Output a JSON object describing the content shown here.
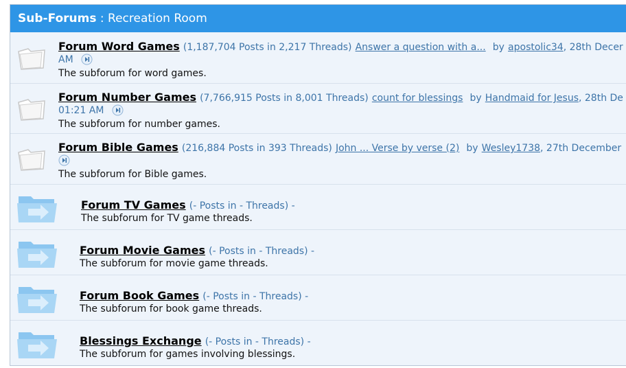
{
  "header": {
    "bold": "Sub-Forums",
    "sep": " : ",
    "title": "Recreation Room"
  },
  "forums": [
    {
      "title": "Forum Word Games",
      "stats": "(1,187,704 Posts in 2,217 Threads)",
      "last_post": "Answer a question with a...",
      "by": "by",
      "author": "apostolic34",
      "date_a": ", 28th Decer",
      "date_b": "AM",
      "desc": "The subforum for word games."
    },
    {
      "title": "Forum Number Games",
      "stats": "(7,766,915 Posts in 8,001 Threads)",
      "last_post": "count for blessings",
      "by": "by",
      "author": "Handmaid for Jesus",
      "date_a": ", 28th De",
      "date_b": "01:21 AM",
      "desc": "The subforum for number games."
    },
    {
      "title": "Forum Bible Games",
      "stats": "(216,884 Posts in 393 Threads)",
      "last_post": "John ... Verse by verse (2)",
      "by": "by",
      "author": "Wesley1738",
      "date_a": ", 27th December",
      "date_b": "",
      "desc": "The subforum for Bible games."
    },
    {
      "title": "Forum TV Games",
      "stats": "(- Posts in - Threads) -",
      "desc": "The subforum for TV game threads."
    },
    {
      "title": "Forum Movie Games",
      "stats": "(- Posts in - Threads) -",
      "desc": "The subforum for movie game threads."
    },
    {
      "title": "Forum Book Games",
      "stats": "(- Posts in - Threads) -",
      "desc": "The subforum for book game threads."
    },
    {
      "title": "Blessings Exchange",
      "stats": "(- Posts in - Threads) -",
      "desc": "The subforum for games involving blessings."
    }
  ],
  "colors": {
    "header_bg": "#2e95e6",
    "link": "#3d74a8",
    "panel_bg": "#eef4fb"
  },
  "icons": {
    "forum_folder": "folder-icon",
    "link_folder": "folder-arrow-icon",
    "go_last": "go-to-last-post-icon"
  }
}
